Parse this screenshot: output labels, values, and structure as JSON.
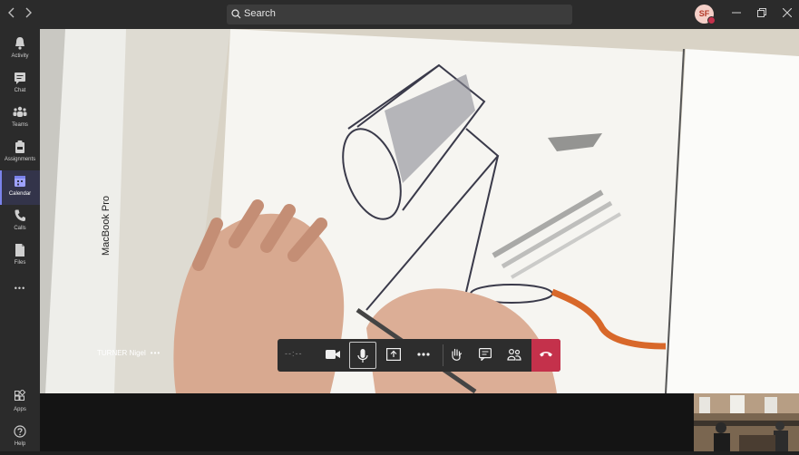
{
  "titlebar": {
    "back_icon": "chevron-left-icon",
    "forward_icon": "chevron-right-icon",
    "search_placeholder": "Search",
    "avatar_initials": "SF",
    "status_color": "#c4314b"
  },
  "rail": {
    "items": [
      {
        "label": "Activity",
        "icon": "bell-icon"
      },
      {
        "label": "Chat",
        "icon": "chat-icon"
      },
      {
        "label": "Teams",
        "icon": "teams-icon"
      },
      {
        "label": "Assignments",
        "icon": "assignments-icon"
      },
      {
        "label": "Calendar",
        "icon": "calendar-icon"
      },
      {
        "label": "Calls",
        "icon": "phone-icon"
      },
      {
        "label": "Files",
        "icon": "file-icon"
      }
    ],
    "more": "•••",
    "apps_label": "Apps",
    "help_label": "Help",
    "accent": "#7b83eb"
  },
  "call": {
    "participant_name": "TURNER Nigel",
    "participant_more": "•••",
    "timer": "--:--",
    "hangup_color": "#c4314b"
  }
}
